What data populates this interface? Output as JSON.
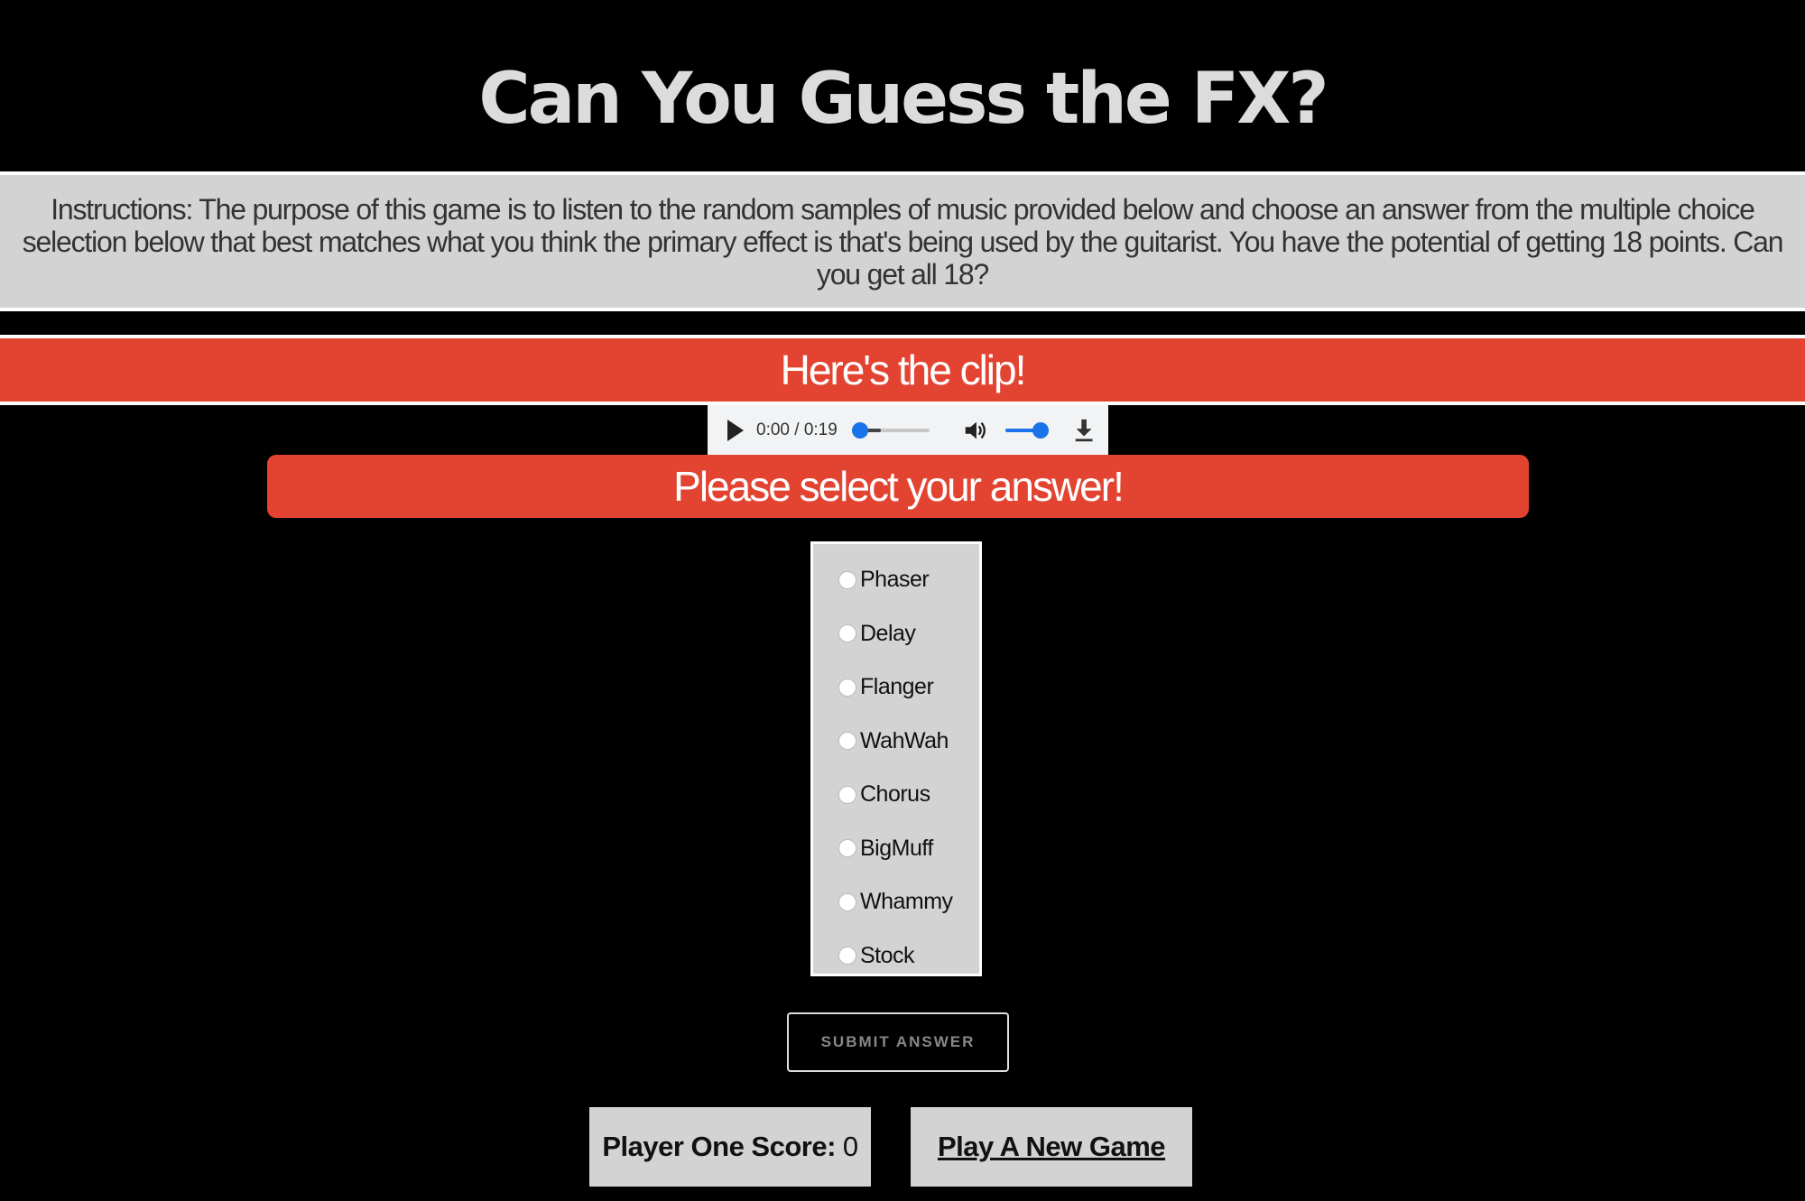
{
  "header": {
    "title": "Can You Guess the FX?"
  },
  "instructions": {
    "text": "Instructions: The purpose of this game is to listen to the random samples of music provided below and choose an answer from the multiple choice selection below that best matches what you think the primary effect is that's being used by the guitarist. You have the potential of getting 18 points. Can you get all 18?"
  },
  "clip": {
    "heading": "Here's the clip!"
  },
  "audio_player": {
    "time": "0:00 / 0:19",
    "progress": 0,
    "volume": 1,
    "accent_color": "#1a73e8"
  },
  "answer": {
    "heading": "Please select your answer!",
    "options": [
      "Phaser",
      "Delay",
      "Flanger",
      "WahWah",
      "Chorus",
      "BigMuff",
      "Whammy",
      "Stock"
    ]
  },
  "buttons": {
    "submit": "SUBMIT ANSWER",
    "new_game": "Play A New Game"
  },
  "score": {
    "label": "Player One Score:",
    "value": "0"
  },
  "colors": {
    "background": "#000000",
    "banner": "#e34432",
    "panel": "#d3d3d3"
  }
}
